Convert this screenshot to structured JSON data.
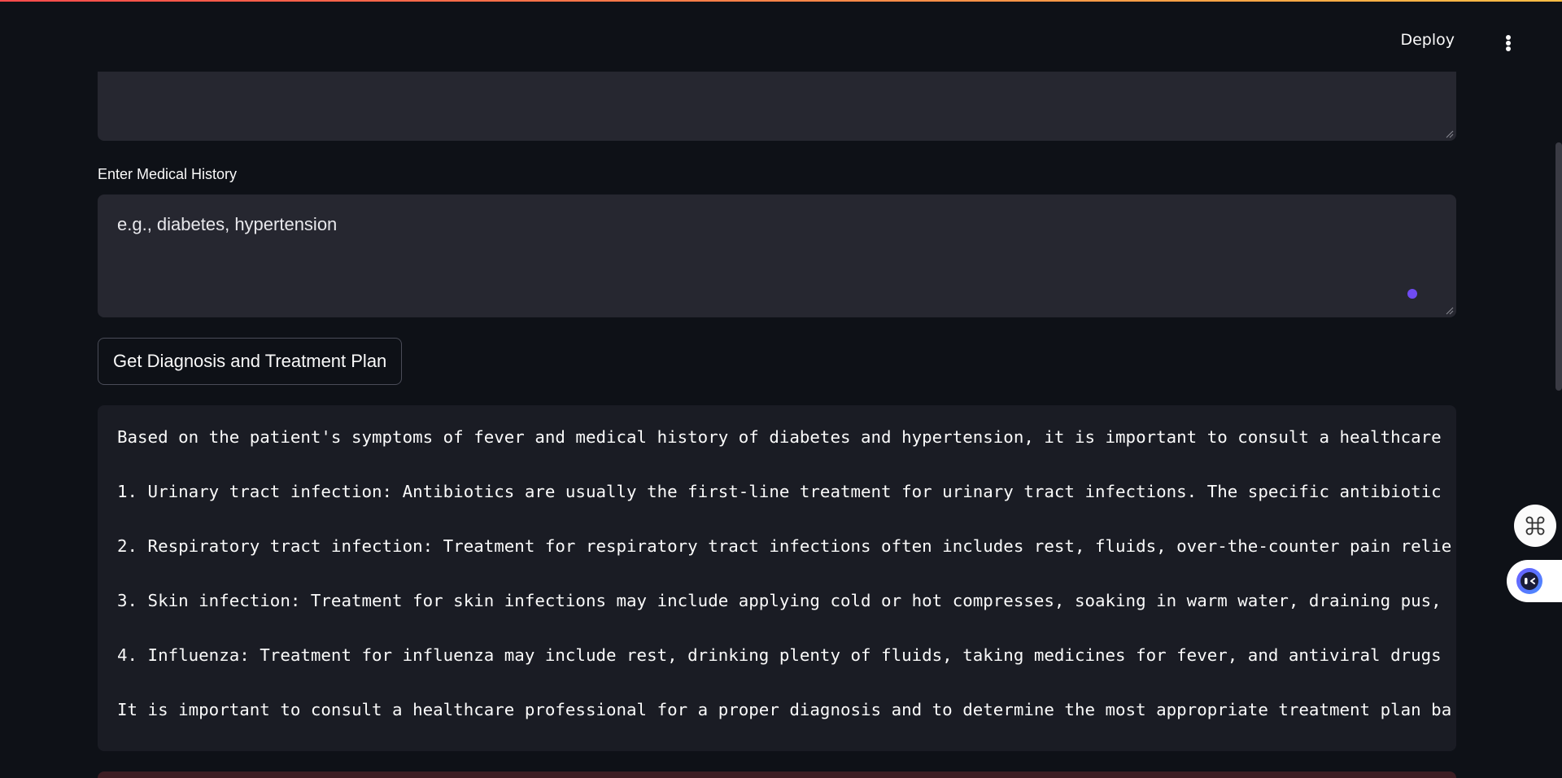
{
  "header": {
    "deploy_label": "Deploy"
  },
  "form": {
    "history_label": "Enter Medical History",
    "history_value": "e.g., diabetes, hypertension",
    "submit_label": "Get Diagnosis and Treatment Plan"
  },
  "result": {
    "lines": [
      "Based on the patient's symptoms of fever and medical history of diabetes and hypertension, it is important to consult a healthcare",
      "1. Urinary tract infection: Antibiotics are usually the first-line treatment for urinary tract infections. The specific antibiotic",
      "2. Respiratory tract infection: Treatment for respiratory tract infections often includes rest, fluids, over-the-counter pain relie",
      "3. Skin infection: Treatment for skin infections may include applying cold or hot compresses, soaking in warm water, draining pus,",
      "4. Influenza: Treatment for influenza may include rest, drinking plenty of fluids, taking medicines for fever, and antiviral drugs",
      "It is important to consult a healthcare professional for a proper diagnosis and to determine the most appropriate treatment plan ba"
    ]
  },
  "icons": {
    "menu": "more-vertical-icon",
    "command": "command-icon",
    "extension": "assistant-extension-icon"
  },
  "colors": {
    "background": "#0e1117",
    "input_bg": "#262730",
    "output_bg": "#1a1c24",
    "accent_dot": "#6f4bf2",
    "top_gradient_start": "#ff4b4b",
    "top_gradient_end": "#ffbd45"
  }
}
